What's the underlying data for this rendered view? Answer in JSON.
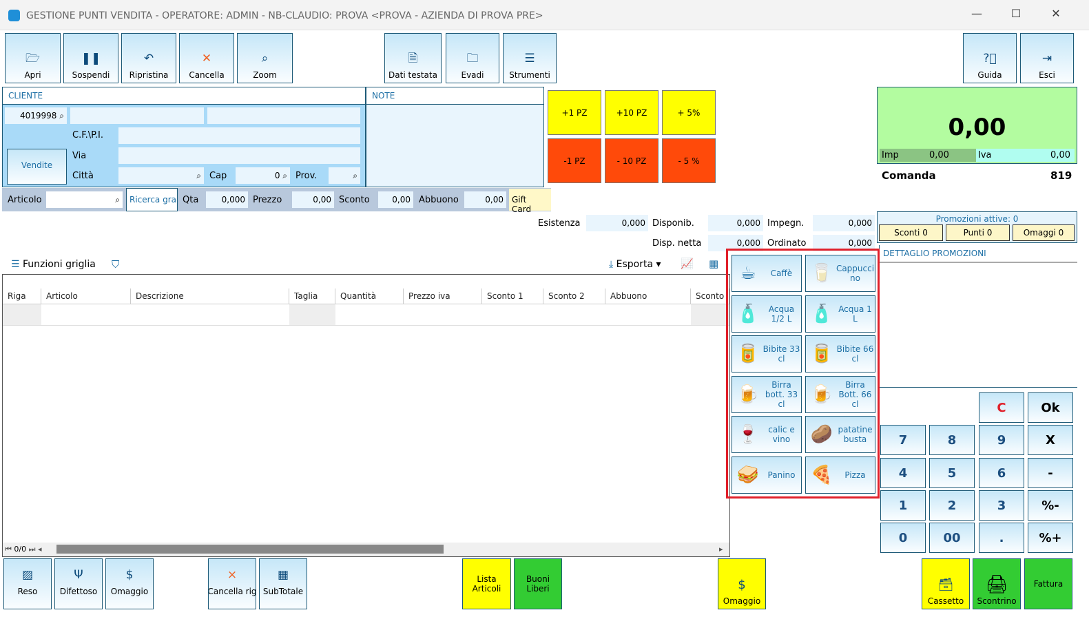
{
  "window": {
    "title": "GESTIONE PUNTI VENDITA - OPERATORE: ADMIN - NB-CLAUDIO: PROVA <PROVA - AZIENDA DI PROVA PRE>",
    "minimize": "—",
    "maximize": "☐",
    "close": "✕"
  },
  "toolbar": {
    "apri": "Apri",
    "sospendi": "Sospendi",
    "ripristina": "Ripristina",
    "cancella": "Cancella",
    "zoom": "Zoom",
    "dati_testata": "Dati testata",
    "evadi": "Evadi",
    "strumenti": "Strumenti",
    "guida": "Guida",
    "esci": "Esci"
  },
  "cliente": {
    "header": "CLIENTE",
    "code": "4019998",
    "cf_label": "C.F.\\P.I.",
    "via_label": "Via",
    "citta_label": "Città",
    "cap_label": "Cap",
    "cap_value": "0",
    "prov_label": "Prov.",
    "vendite": "Vendite"
  },
  "note": {
    "header": "NOTE"
  },
  "quick": {
    "plus1": "+1 PZ",
    "plus10": "+10 PZ",
    "plus5p": "+ 5%",
    "minus1": "-1 PZ",
    "minus10": "- 10 PZ",
    "minus5p": "- 5 %"
  },
  "totale": {
    "value": "0,00",
    "imp_label": "Imp",
    "imp_value": "0,00",
    "iva_label": "Iva",
    "iva_value": "0,00",
    "comanda_label": "Comanda",
    "comanda_value": "819"
  },
  "articolo_bar": {
    "articolo": "Articolo",
    "ricerca": "Ricerca gra",
    "qta": "Qta",
    "qta_value": "0,000",
    "prezzo": "Prezzo",
    "prezzo_value": "0,00",
    "sconto": "Sconto",
    "sconto_value": "0,00",
    "abbuono": "Abbuono",
    "abbuono_value": "0,00",
    "gift": "Gift Card"
  },
  "stock": {
    "esistenza": "Esistenza",
    "esistenza_v": "0,000",
    "disponib": "Disponib.",
    "disponib_v": "0,000",
    "impegn": "Impegn.",
    "impegn_v": "0,000",
    "disp_netta": "Disp. netta",
    "disp_netta_v": "0,000",
    "ordinato": "Ordinato",
    "ordinato_v": "0,000"
  },
  "promo": {
    "title": "Promozioni attive: 0",
    "sconti": "Sconti 0",
    "punti": "Punti 0",
    "omaggi": "Omaggi 0",
    "dettaglio": "DETTAGLIO PROMOZIONI"
  },
  "grid": {
    "funzioni": "Funzioni griglia",
    "esporta": "Esporta",
    "columns": [
      "Riga",
      "Articolo",
      "Descrizione",
      "Taglia",
      "Quantità",
      "Prezzo iva",
      "Sconto 1",
      "Sconto 2",
      "Abbuono",
      "Sconto"
    ],
    "pager": "0/0"
  },
  "products": [
    {
      "label": "Caffè",
      "icon": "☕"
    },
    {
      "label": "Cappucci no",
      "icon": "🥛"
    },
    {
      "label": "Acqua 1/2 L",
      "icon": "🧴"
    },
    {
      "label": "Acqua 1 L",
      "icon": "🧴"
    },
    {
      "label": "Bibite 33 cl",
      "icon": "🥫"
    },
    {
      "label": "Bibite 66 cl",
      "icon": "🥫"
    },
    {
      "label": "Birra bott. 33 cl",
      "icon": "🍺"
    },
    {
      "label": "Birra Bott. 66 cl",
      "icon": "🍺"
    },
    {
      "label": "calic e vino",
      "icon": "🍷"
    },
    {
      "label": "patatine busta",
      "icon": "🥔"
    },
    {
      "label": "Panino",
      "icon": "🥪"
    },
    {
      "label": "Pizza",
      "icon": "🍕"
    }
  ],
  "keypad": [
    [
      "",
      "",
      "C",
      "Ok"
    ],
    [
      "7",
      "8",
      "9",
      "X"
    ],
    [
      "4",
      "5",
      "6",
      "-"
    ],
    [
      "1",
      "2",
      "3",
      "%-"
    ],
    [
      "0",
      "00",
      ".",
      "%+"
    ]
  ],
  "bottom": {
    "reso": "Reso",
    "difettoso": "Difettoso",
    "omaggio": "Omaggio",
    "cancella_riga": "Cancella rig",
    "subtotale": "SubTotale",
    "lista_articoli": "Lista Articoli",
    "buoni_liberi": "Buoni Liberi",
    "omaggio2": "Omaggio",
    "cassetto": "Cassetto",
    "scontrino": "Scontrino",
    "fattura": "Fattura"
  },
  "colors": {
    "yellow": "#ffff00",
    "orange_red": "#ff4a0a",
    "green": "#33cc33",
    "total_bg": "#b3fca0",
    "highlight": "#e0202a"
  }
}
